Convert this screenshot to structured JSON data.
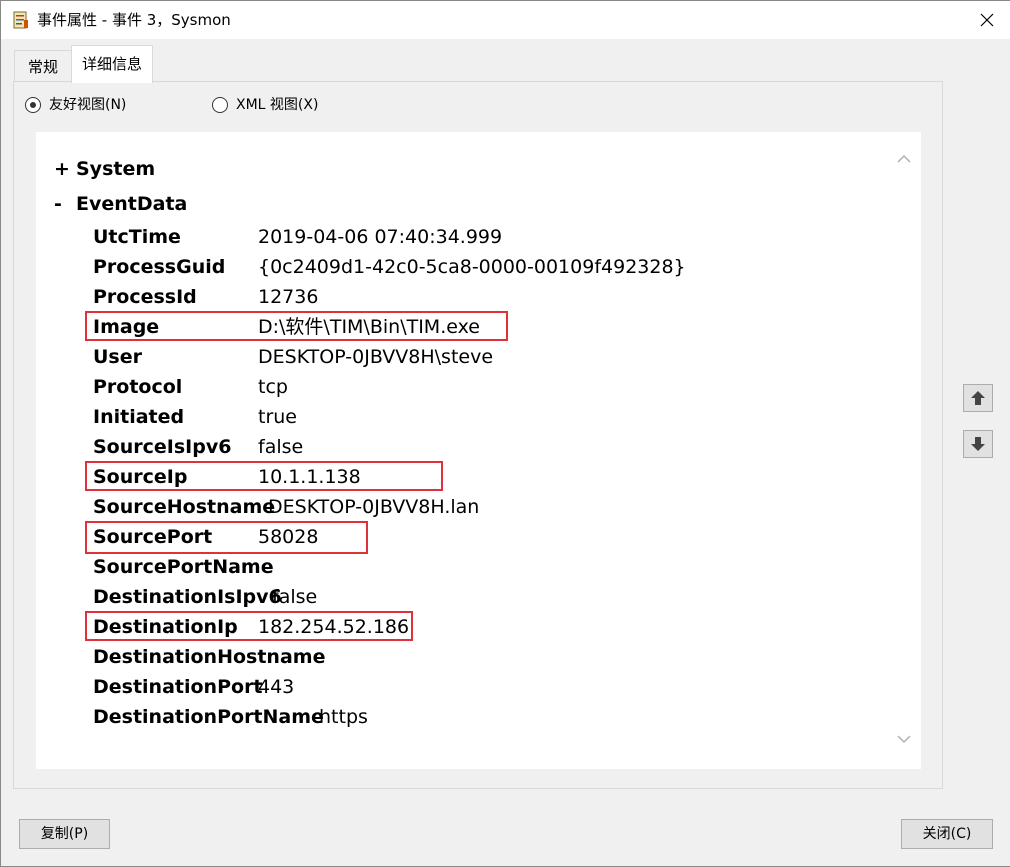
{
  "window": {
    "title": "事件属性 - 事件 3，Sysmon"
  },
  "tabs": {
    "general": "常规",
    "details": "详细信息"
  },
  "view_options": {
    "friendly": "友好视图(N)",
    "xml": "XML 视图(X)",
    "selected": "friendly"
  },
  "tree": {
    "system": {
      "sign": "+",
      "name": "System"
    },
    "eventdata": {
      "sign": "-",
      "name": "EventData"
    },
    "fields": [
      {
        "key": "UtcTime",
        "value": "2019-04-06 07:40:34.999"
      },
      {
        "key": "ProcessGuid",
        "value": "{0c2409d1-42c0-5ca8-0000-00109f492328}"
      },
      {
        "key": "ProcessId",
        "value": "12736"
      },
      {
        "key": "Image",
        "value": "D:\\软件\\TIM\\Bin\\TIM.exe"
      },
      {
        "key": "User",
        "value": "DESKTOP-0JBVV8H\\steve"
      },
      {
        "key": "Protocol",
        "value": "tcp"
      },
      {
        "key": "Initiated",
        "value": "true"
      },
      {
        "key": "SourceIsIpv6",
        "value": "false"
      },
      {
        "key": "SourceIp",
        "value": "10.1.1.138"
      },
      {
        "key": "SourceHostname",
        "value": "DESKTOP-0JBVV8H.lan"
      },
      {
        "key": "SourcePort",
        "value": "58028"
      },
      {
        "key": "SourcePortName",
        "value": ""
      },
      {
        "key": "DestinationIsIpv6",
        "value": "false"
      },
      {
        "key": "DestinationIp",
        "value": "182.254.52.186"
      },
      {
        "key": "DestinationHostname",
        "value": ""
      },
      {
        "key": "DestinationPort",
        "value": "443"
      },
      {
        "key": "DestinationPortName",
        "value": "https"
      }
    ]
  },
  "buttons": {
    "copy": "复制(P)",
    "close": "关闭(C)"
  },
  "icons": {
    "window": "event-log-icon",
    "close": "close-icon",
    "up": "arrow-up-icon",
    "down": "arrow-down-icon"
  },
  "colors": {
    "highlight": "#e0303a"
  }
}
